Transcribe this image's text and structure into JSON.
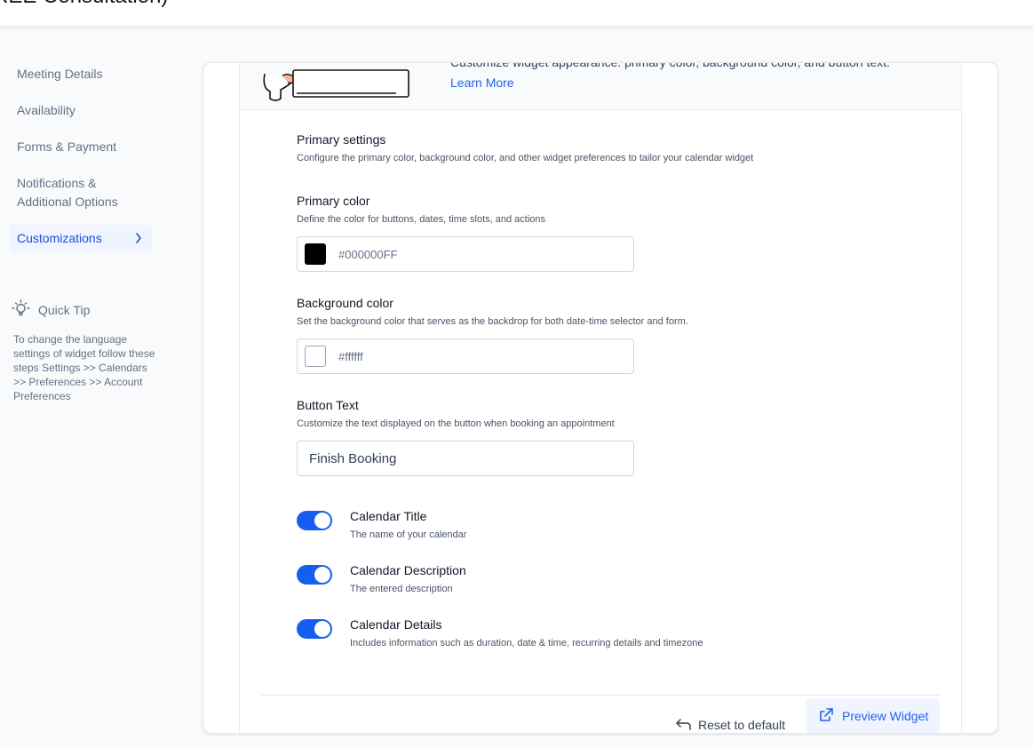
{
  "header": {
    "title": "REE Consultation)"
  },
  "sidebar": {
    "items": [
      {
        "label": "Meeting Details"
      },
      {
        "label": "Availability"
      },
      {
        "label": "Forms & Payment"
      },
      {
        "label": "Notifications & Additional Options"
      },
      {
        "label": "Customizations"
      }
    ],
    "active_index": 4,
    "quick_tip": {
      "title": "Quick Tip",
      "body": "To change the language settings of widget follow these steps Settings >> Calendars >> Preferences >> Account Preferences"
    }
  },
  "banner": {
    "text": "Customize widget appearance: primary color, background color, and button text.",
    "learn_more": "Learn More"
  },
  "primary_settings": {
    "title": "Primary settings",
    "description": "Configure the primary color, background color, and other widget preferences to tailor your calendar widget"
  },
  "primary_color": {
    "label": "Primary color",
    "description": "Define the color for buttons, dates, time slots, and actions",
    "value": "#000000FF",
    "swatch": "#000000"
  },
  "background_color": {
    "label": "Background color",
    "description": "Set the background color that serves as the backdrop for both date-time selector and form.",
    "value": "#ffffff",
    "swatch": "#ffffff"
  },
  "button_text": {
    "label": "Button Text",
    "description": "Customize the text displayed on the button when booking an appointment",
    "value": "Finish Booking"
  },
  "toggles": [
    {
      "label": "Calendar Title",
      "description": "The name of your calendar",
      "on": true
    },
    {
      "label": "Calendar Description",
      "description": "The entered description",
      "on": true
    },
    {
      "label": "Calendar Details",
      "description": "Includes information such as duration, date & time, recurring details and timezone",
      "on": true
    }
  ],
  "footer": {
    "reset_label": "Reset to default",
    "preview_label": "Preview Widget"
  },
  "colors": {
    "accent": "#155eef",
    "link": "#2563eb",
    "active_bg": "#eff4ff"
  }
}
